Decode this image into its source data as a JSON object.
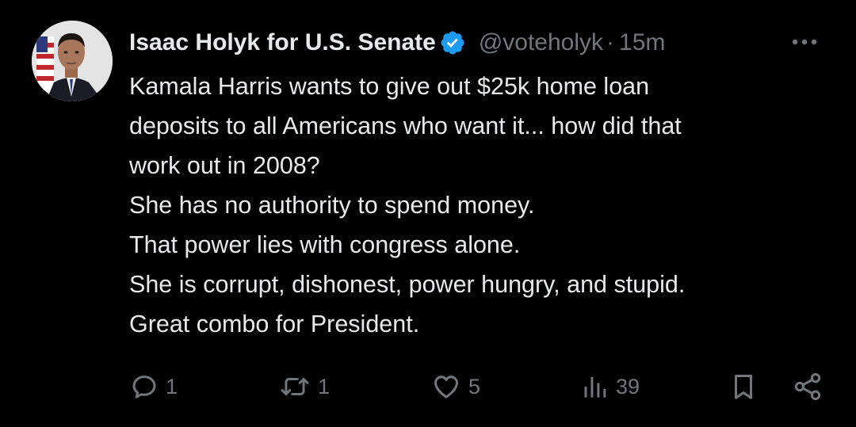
{
  "tweet": {
    "author": {
      "display_name": "Isaac Holyk for U.S. Senate",
      "handle": "@voteholyk",
      "verified_icon": "verified-badge-icon"
    },
    "separator": "·",
    "time": "15m",
    "text_lines": [
      "Kamala Harris wants to give out $25k home loan",
      "deposits to all Americans who want it... how did that",
      "work out in 2008?",
      "She has no authority to spend money.",
      "That power lies with congress alone.",
      "She is corrupt, dishonest, power hungry, and stupid.",
      "Great combo for President."
    ],
    "actions": {
      "reply": "1",
      "repost": "1",
      "like": "5",
      "views": "39"
    }
  },
  "colors": {
    "background": "#000000",
    "text": "#e7e9ea",
    "muted": "#71767b",
    "verified": "#1d9bf0"
  }
}
